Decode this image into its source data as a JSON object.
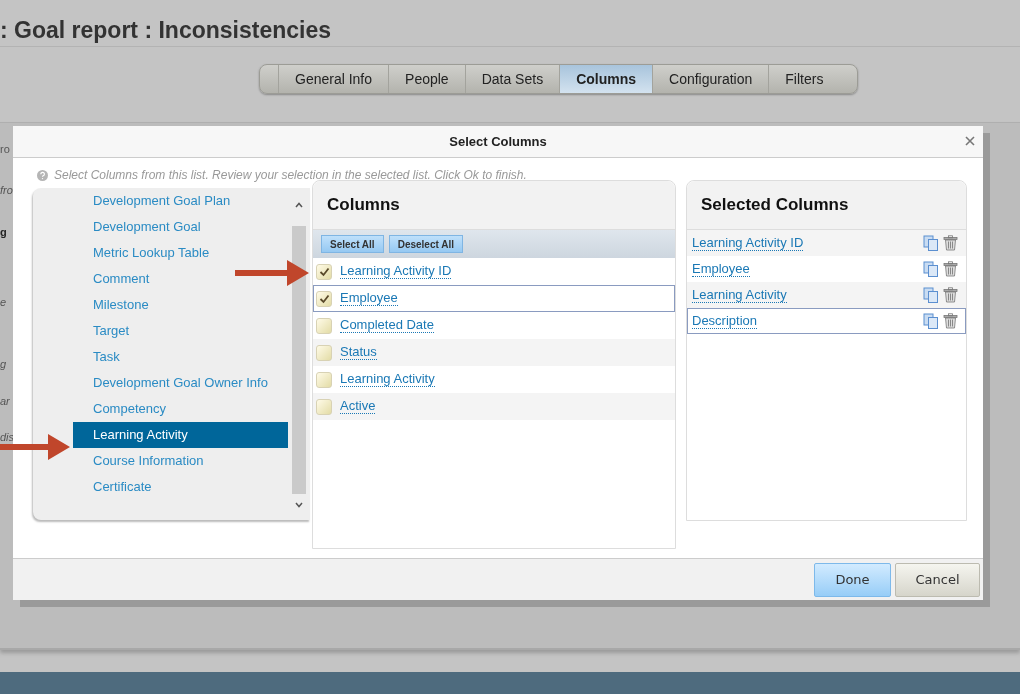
{
  "page": {
    "title": ": Goal report : Inconsistencies",
    "tabs": [
      {
        "label": "General Info",
        "selected": false
      },
      {
        "label": "People",
        "selected": false
      },
      {
        "label": "Data Sets",
        "selected": false
      },
      {
        "label": "Columns",
        "selected": true
      },
      {
        "label": "Configuration",
        "selected": false
      },
      {
        "label": "Filters",
        "selected": false
      }
    ],
    "background_fragments": [
      {
        "text": "ro",
        "kind": "plain"
      },
      {
        "text": "fro",
        "kind": "italic"
      },
      {
        "text": "g",
        "kind": "bold"
      },
      {
        "text": "e",
        "kind": "italic"
      },
      {
        "text": "g",
        "kind": "italic"
      },
      {
        "text": "ar",
        "kind": "italic"
      },
      {
        "text": "dis",
        "kind": "italic"
      }
    ]
  },
  "dialog": {
    "title": "Select Columns",
    "hint": "Select Columns from this list. Review your selection in the selected list. Click Ok to finish.",
    "data_sets": [
      {
        "label": "Development Goal Plan",
        "selected": false
      },
      {
        "label": "Development Goal",
        "selected": false
      },
      {
        "label": "Metric Lookup Table",
        "selected": false
      },
      {
        "label": "Comment",
        "selected": false
      },
      {
        "label": "Milestone",
        "selected": false
      },
      {
        "label": "Target",
        "selected": false
      },
      {
        "label": "Task",
        "selected": false
      },
      {
        "label": "Development Goal Owner Info",
        "selected": false
      },
      {
        "label": "Competency",
        "selected": false
      },
      {
        "label": "Learning Activity",
        "selected": true
      },
      {
        "label": "Course Information",
        "selected": false
      },
      {
        "label": "Certificate",
        "selected": false
      }
    ],
    "columns": {
      "heading": "Columns",
      "select_all": "Select All",
      "deselect_all": "Deselect All",
      "items": [
        {
          "label": "Learning Activity ID",
          "checked": true,
          "selected": false
        },
        {
          "label": "Employee",
          "checked": true,
          "selected": true
        },
        {
          "label": "Completed Date",
          "checked": false,
          "selected": false
        },
        {
          "label": "Status",
          "checked": false,
          "selected": false
        },
        {
          "label": "Learning Activity",
          "checked": false,
          "selected": false
        },
        {
          "label": "Active",
          "checked": false,
          "selected": false
        }
      ]
    },
    "selected_columns": {
      "heading": "Selected Columns",
      "items": [
        {
          "label": "Learning Activity ID",
          "selected": false
        },
        {
          "label": "Employee",
          "selected": false
        },
        {
          "label": "Learning Activity",
          "selected": false
        },
        {
          "label": "Description",
          "selected": true
        }
      ]
    },
    "buttons": {
      "done": "Done",
      "cancel": "Cancel"
    }
  }
}
